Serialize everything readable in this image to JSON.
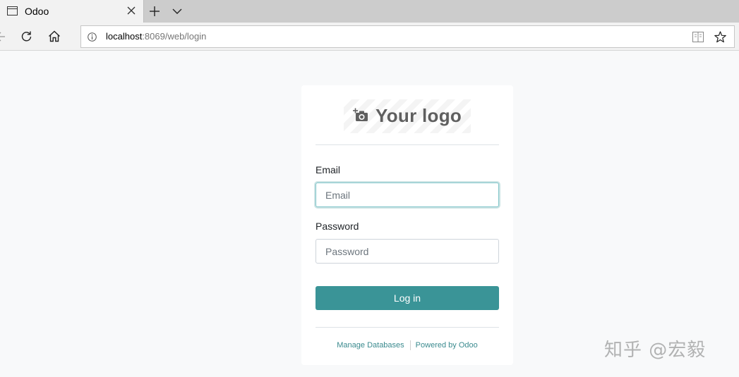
{
  "browser": {
    "tab": {
      "title": "Odoo"
    },
    "icons": {
      "tab": "window-icon",
      "close": "close-icon",
      "new_tab": "plus-icon",
      "tab_list": "chevron-down-icon",
      "back": "arrow-left-icon",
      "refresh": "refresh-icon",
      "home": "home-icon",
      "info": "info-icon",
      "reading_view": "book-icon",
      "favorite": "star-icon"
    },
    "address_bar": {
      "host": "localhost",
      "path": ":8069/web/login"
    }
  },
  "login": {
    "logo_text": "Your logo",
    "logo_icon": "camera-add-icon",
    "email": {
      "label": "Email",
      "placeholder": "Email",
      "value": ""
    },
    "password": {
      "label": "Password",
      "placeholder": "Password",
      "value": ""
    },
    "submit_label": "Log in",
    "footer": {
      "manage_databases": "Manage Databases",
      "powered_by": "Powered by Odoo"
    }
  },
  "watermark": "知乎 @宏毅",
  "colors": {
    "accent": "#3a9497",
    "page_background": "#f8f9fa",
    "card_background": "#ffffff",
    "link": "#3a8a8e"
  }
}
